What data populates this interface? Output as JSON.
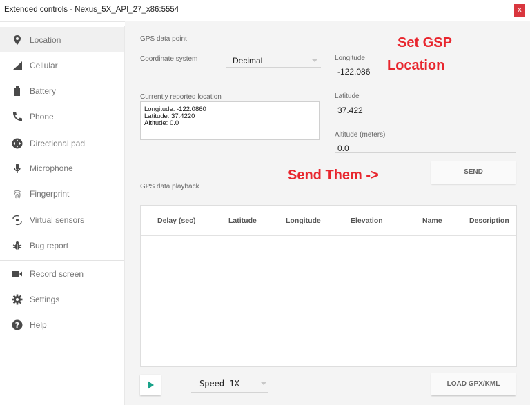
{
  "window": {
    "title": "Extended controls - Nexus_5X_API_27_x86:5554",
    "close_label": "x"
  },
  "sidebar": {
    "items": [
      {
        "label": "Location",
        "icon": "location-pin-icon"
      },
      {
        "label": "Cellular",
        "icon": "cellular-signal-icon"
      },
      {
        "label": "Battery",
        "icon": "battery-icon"
      },
      {
        "label": "Phone",
        "icon": "phone-icon"
      },
      {
        "label": "Directional pad",
        "icon": "directional-pad-icon"
      },
      {
        "label": "Microphone",
        "icon": "microphone-icon"
      },
      {
        "label": "Fingerprint",
        "icon": "fingerprint-icon"
      },
      {
        "label": "Virtual sensors",
        "icon": "virtual-sensors-icon"
      },
      {
        "label": "Bug report",
        "icon": "bug-icon"
      },
      {
        "label": "Record screen",
        "icon": "video-camera-icon"
      },
      {
        "label": "Settings",
        "icon": "gear-icon"
      },
      {
        "label": "Help",
        "icon": "help-icon"
      }
    ]
  },
  "gps": {
    "section_title": "GPS data point",
    "coord_label": "Coordinate system",
    "coord_value": "Decimal",
    "current_label": "Currently reported location",
    "current_lines": [
      "Longitude: -122.0860",
      "Latitude: 37.4220",
      "Altitude: 0.0"
    ],
    "longitude_label": "Longitude",
    "longitude_value": "-122.086",
    "latitude_label": "Latitude",
    "latitude_value": "37.422",
    "altitude_label": "Altitude (meters)",
    "altitude_value": "0.0",
    "send_label": "SEND"
  },
  "annotations": {
    "set_line1": "Set GSP",
    "set_line2": "Location",
    "send_them": "Send Them ->",
    "color": "#e8262e"
  },
  "playback": {
    "section_title": "GPS data playback",
    "columns": [
      "Delay (sec)",
      "Latitude",
      "Longitude",
      "Elevation",
      "Name",
      "Description"
    ],
    "speed_value": "Speed 1X",
    "load_label": "LOAD GPX/KML"
  },
  "colors": {
    "accent": "#1aa38a",
    "close": "#d9363e"
  }
}
